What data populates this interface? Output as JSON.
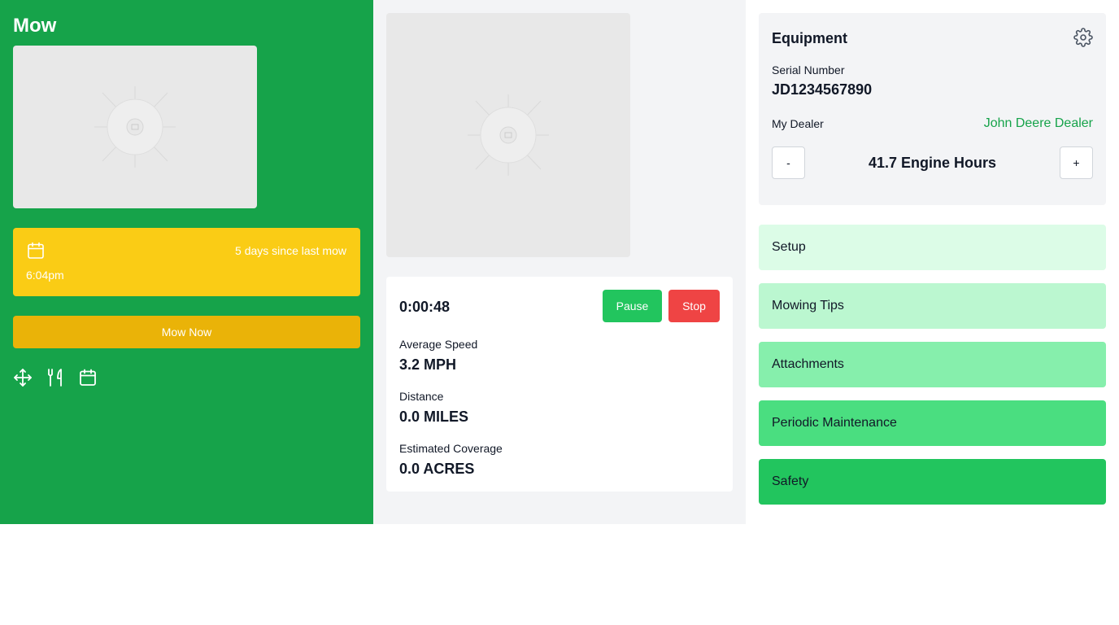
{
  "app": {
    "title": "Mow"
  },
  "status": {
    "since_text": "5 days since last mow",
    "time": "6:04pm"
  },
  "actions": {
    "mow_now": "Mow Now"
  },
  "toolbar": {
    "icons": [
      "move-icon",
      "utensils-icon",
      "calendar-icon"
    ]
  },
  "session": {
    "timer": "0:00:48",
    "pause_label": "Pause",
    "stop_label": "Stop",
    "metrics": [
      {
        "label": "Average Speed",
        "value": "3.2 MPH"
      },
      {
        "label": "Distance",
        "value": "0.0 MILES"
      },
      {
        "label": "Estimated Coverage",
        "value": "0.0 ACRES"
      }
    ]
  },
  "equipment": {
    "title": "Equipment",
    "serial_label": "Serial Number",
    "serial_value": "JD1234567890",
    "dealer_label": "My Dealer",
    "dealer_link": "John Deere Dealer",
    "minus_label": "-",
    "plus_label": "+",
    "engine_hours": "41.7 Engine Hours"
  },
  "menu": [
    {
      "label": "Setup",
      "color": "#dcfce7"
    },
    {
      "label": "Mowing Tips",
      "color": "#bbf7d0"
    },
    {
      "label": "Attachments",
      "color": "#86efac"
    },
    {
      "label": "Periodic Maintenance",
      "color": "#4ade80"
    },
    {
      "label": "Safety",
      "color": "#22c55e"
    }
  ],
  "colors": {
    "primary_green": "#16a34a",
    "status_yellow": "#facc15",
    "button_yellow": "#eab308",
    "pause_green": "#22c55e",
    "stop_red": "#ef4444",
    "panel_gray": "#f3f4f6"
  }
}
